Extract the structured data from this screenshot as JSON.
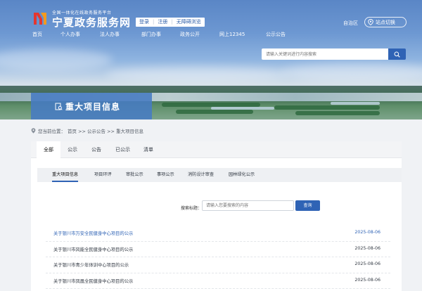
{
  "header": {
    "logo_subtitle": "全国一体化在线政务服务平台",
    "logo_title": "宁夏政务服务网",
    "auth": {
      "login": "登录",
      "register": "注册",
      "accessible": "无障碍浏览"
    },
    "region_label": "自治区",
    "region_switch": "站点切换",
    "nav": [
      "首页",
      "个人办事",
      "法人办事",
      "部门办事",
      "政务公开",
      "网上12345",
      "公示公告"
    ]
  },
  "search": {
    "placeholder": "请输入关键词进行内容搜索"
  },
  "banner": {
    "title": "重大项目信息"
  },
  "breadcrumb": {
    "prefix": "您当前位置：",
    "path": "首页 >> 公示公告 >> 重大项目信息"
  },
  "tabs": [
    {
      "label": "全部",
      "active": true
    },
    {
      "label": "公示",
      "active": false
    },
    {
      "label": "公告",
      "active": false
    },
    {
      "label": "已公示",
      "active": false
    },
    {
      "label": "清单",
      "active": false
    }
  ],
  "subtabs": [
    {
      "label": "重大项目信息",
      "active": true
    },
    {
      "label": "项目环评",
      "active": false
    },
    {
      "label": "审批公示",
      "active": false
    },
    {
      "label": "事项公示",
      "active": false
    },
    {
      "label": "消防设计审查",
      "active": false
    },
    {
      "label": "园林绿化公示",
      "active": false
    }
  ],
  "filter": {
    "label": "搜索标题：",
    "placeholder": "请输入您要搜索的内容",
    "button": "查询"
  },
  "items": [
    {
      "title": "关于银川市万安全民健身中心项目的公示",
      "date": "2025-08-06"
    },
    {
      "title": "关于银川市风能全民健身中心项目的公示",
      "date": "2025-08-06"
    },
    {
      "title": "关于银川市青少年体训中心项目的公示",
      "date": "2025-08-06"
    },
    {
      "title": "关于银川市凤凰全民健身中心项目的公示",
      "date": "2025-08-06"
    }
  ],
  "colors": {
    "primary": "#2f63b5",
    "banner_tag": "#477bc3",
    "logo_red": "#e5362f",
    "logo_orange": "#f39a1e"
  }
}
